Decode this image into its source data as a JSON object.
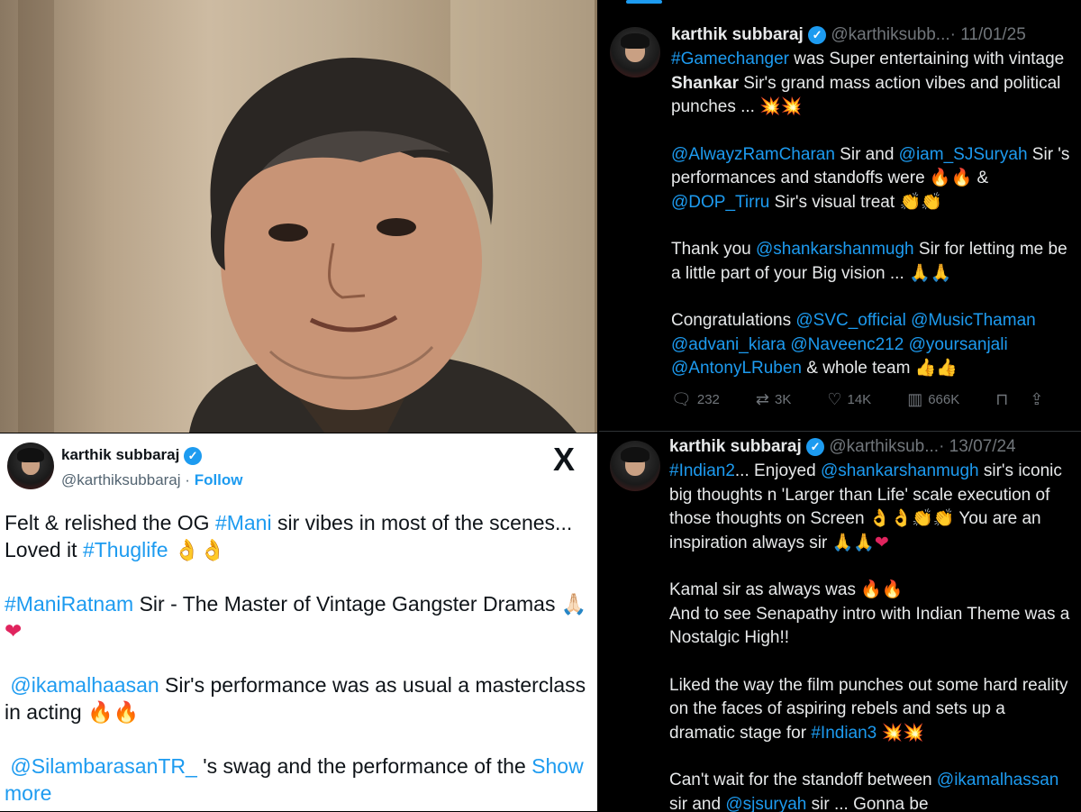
{
  "light_tweet": {
    "name": "karthik subbaraj",
    "handle": "@karthiksubbaraj",
    "sep": "·",
    "follow": "Follow",
    "x_logo": "X",
    "p1": {
      "t1": "Felt & relished the OG ",
      "h1": "#Mani",
      "t2": " sir vibes in most of the scenes... Loved it ",
      "h2": "#Thuglife",
      "e1": "👌👌"
    },
    "p2": {
      "h1": "#ManiRatnam",
      "t1": " Sir - The Master of Vintage Gangster Dramas ",
      "e1": "🙏🏻",
      "e2": "❤"
    },
    "p3": {
      "h1": "@ikamalhaasan",
      "t1": " Sir's performance was as usual a masterclass in acting ",
      "e1": "🔥🔥"
    },
    "p4": {
      "h1": "@SilambarasanTR_",
      "t1": " 's swag and the performance of the ",
      "show_more": "Show more"
    }
  },
  "dark_tweet_1": {
    "name": "karthik subbaraj",
    "handle": "@karthiksubb...",
    "date": "· 11/01/25",
    "p1": {
      "h1": "#Gamechanger",
      "t1": " was Super entertaining with vintage ",
      "b1": "Shankar",
      "t2": " Sir's grand mass action vibes and political punches ... ",
      "e1": "💥💥"
    },
    "p2": {
      "h1": "@AlwayzRamCharan",
      "t1": " Sir and ",
      "h2": "@iam_SJSuryah",
      "t2": " Sir 's performances and standoffs were ",
      "e1": "🔥🔥",
      "t3": " & ",
      "h3": "@DOP_Tirru",
      "t4": " Sir's visual treat ",
      "e2": "👏👏"
    },
    "p3": {
      "t1": "Thank you ",
      "h1": "@shankarshanmugh",
      "t2": " Sir for letting me be a little part of your Big vision ... ",
      "e1": "🙏🙏"
    },
    "p4": {
      "t1": "Congratulations ",
      "h1": "@SVC_official",
      "h2": "@MusicThaman",
      "h3": "@advani_kiara",
      "h4": "@Naveenc212",
      "h5": "@yoursanjali",
      "h6": "@AntonyLRuben",
      "t2": " & whole team ",
      "e1": "👍👍"
    },
    "actions": {
      "replies": "232",
      "reposts": "3K",
      "likes": "14K",
      "views": "666K"
    },
    "icons": {
      "reply": "reply-icon",
      "repost": "repost-icon",
      "like": "like-icon",
      "views": "views-icon",
      "bookmark": "bookmark-icon",
      "share": "share-icon"
    }
  },
  "dark_tweet_2": {
    "name": "karthik subbaraj",
    "handle": "@karthiksub...",
    "date": "· 13/07/24",
    "p1": {
      "h1": "#Indian2",
      "t1": "... Enjoyed ",
      "h2": "@shankarshanmugh",
      "t2": " sir's iconic big thoughts n 'Larger than Life' scale execution of those thoughts on Screen ",
      "e1": "👌👌👏👏",
      "t3": " You are an inspiration always sir ",
      "e2": "🙏🙏",
      "e3": "❤"
    },
    "p2": {
      "t1": "Kamal sir as always was ",
      "e1": "🔥🔥",
      "t2": "And to see Senapathy intro with Indian Theme was a Nostalgic High!!"
    },
    "p3": {
      "t1": "Liked the way the film punches out some hard reality on the faces of aspiring rebels and sets up a dramatic stage for ",
      "h1": "#Indian3",
      "e1": "💥💥"
    },
    "p4": {
      "t1": "Can't wait for the standoff between ",
      "h1": "@ikamalhassan",
      "t2": " sir and ",
      "h2": "@sjsuryah",
      "t3": " sir ... Gonna be"
    }
  },
  "colors": {
    "accent": "#1d9bf0",
    "dark_bg": "#000000",
    "light_bg": "#ffffff"
  }
}
